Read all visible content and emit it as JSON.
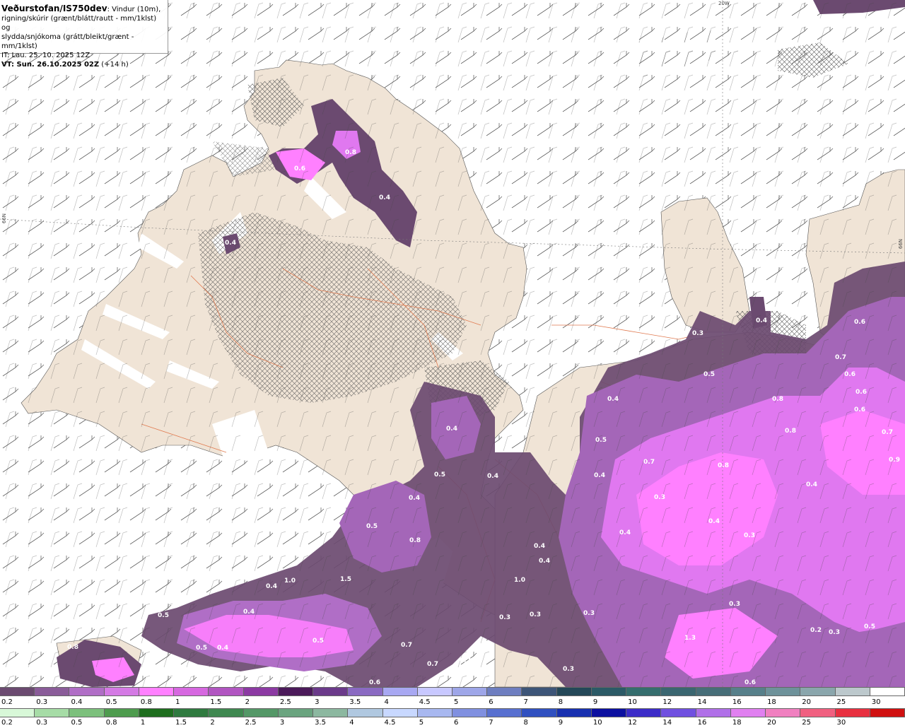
{
  "header": {
    "brand": "Veðurstofan/IS750dev",
    "line1_rest": ": Vindur (10m),",
    "line2": "rigning/skúrir (grænt/blátt/rautt - mm/1klst) og",
    "line3": "slydda/snjókoma (grátt/bleikt/grænt - mm/1klst)",
    "it": "IT: Lau. 25. 10. 2025 12Z",
    "vt_label": "VT: Sun. 26.10.2025 02Z",
    "vt_offset": " (+14 h)"
  },
  "grid_labels": {
    "lon": "20W",
    "lat_left": "66N",
    "lat_right": "66N"
  },
  "precip_labels": [
    "0.8",
    "0.6",
    "0.4",
    "0.4",
    "0.3",
    "0.4",
    "0.5",
    "0.6",
    "0.8",
    "0.6",
    "0.6",
    "0.7",
    "0.6",
    "0.4",
    "0.5",
    "0.4",
    "0.7",
    "0.8",
    "0.7",
    "0.8",
    "0.9",
    "0.4",
    "0.3",
    "0.4",
    "0.4",
    "0.3",
    "0.4",
    "0.4",
    "0.5",
    "0.4",
    "0.5",
    "0.8",
    "0.4",
    "0.4",
    "1.0",
    "1.0",
    "1.5",
    "0.4",
    "0.3",
    "0.3",
    "0.3",
    "0.4",
    "0.5",
    "0.5",
    "0.4",
    "0.5",
    "0.7",
    "0.7",
    "0.7",
    "0.3",
    "1.3",
    "0.3",
    "0.2",
    "0.3",
    "0.5",
    "0.6",
    "0.6",
    "0.8"
  ],
  "colors": {
    "land": "#f0e4d6",
    "sea": "#ffffff",
    "border_lines": "#e07a50",
    "precip_dark": "#6b4a70",
    "precip_mid": "#a466b8",
    "precip_light": "#e078f0",
    "precip_bright": "#ff80ff"
  },
  "legend": {
    "row1": {
      "labels": [
        "0.2",
        "0.3",
        "0.4",
        "0.5",
        "0.8",
        "1",
        "1.5",
        "2",
        "2.5",
        "3",
        "3.5",
        "4",
        "4.5",
        "5",
        "6",
        "7",
        "8",
        "9",
        "10",
        "12",
        "14",
        "16",
        "18",
        "20",
        "25",
        "30"
      ],
      "colors": [
        "#6b4a70",
        "#8a5c99",
        "#b06ec6",
        "#d47ae4",
        "#ff80ff",
        "#d668e0",
        "#b155c1",
        "#8c3aa3",
        "#4b1a5a",
        "#6b3a8a",
        "#8a6ac2",
        "#a8a8f2",
        "#c8c8ff",
        "#9ea6e8",
        "#6e7ec0",
        "#3d5578",
        "#244858",
        "#2b5a66",
        "#356e6e",
        "#3a6670",
        "#476e78",
        "#57808a",
        "#6e929a",
        "#8aa6ac",
        "#bcc8cc",
        "#ffffff"
      ]
    },
    "row2": {
      "labels": [
        "0.2",
        "0.3",
        "0.5",
        "0.8",
        "1",
        "1.5",
        "2",
        "2.5",
        "3",
        "3.5",
        "4",
        "4.5",
        "5",
        "6",
        "7",
        "8",
        "9",
        "10",
        "12",
        "14",
        "16",
        "18",
        "20",
        "25",
        "30"
      ],
      "colors": [
        "#d8f8d8",
        "#a6dca6",
        "#7cc07c",
        "#4e9c4e",
        "#1e6e1e",
        "#2f7a3f",
        "#3f8850",
        "#549867",
        "#6aa47f",
        "#8cb8a0",
        "#b0c8e0",
        "#c8d8ff",
        "#a8b8f0",
        "#8090e0",
        "#5870d0",
        "#3050c0",
        "#1830b0",
        "#0c10a0",
        "#3c2cc8",
        "#7050e0",
        "#b070e8",
        "#e080f0",
        "#f080c0",
        "#f06080",
        "#e83040",
        "#d01010"
      ]
    }
  }
}
